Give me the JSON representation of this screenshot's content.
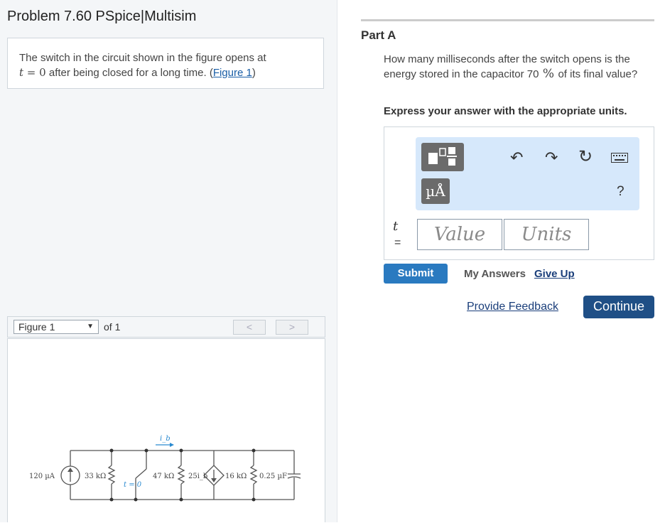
{
  "problem": {
    "title": "Problem 7.60 PSpice|Multisim",
    "text_before": "The switch in the circuit shown in the figure opens at",
    "t_var": "t",
    "eq_zero": " = 0",
    "text_after": " after being closed for a long time. (",
    "figure_link": "Figure 1",
    "close_paren": ")"
  },
  "figure": {
    "selected": "Figure 1",
    "of_text": "of 1",
    "prev": "<",
    "next": ">"
  },
  "circuit": {
    "src_label": "120 µA",
    "r1_label": "33 kΩ",
    "ib_label": "i_b",
    "switch_label": "t = 0",
    "r2_label": "47 kΩ",
    "dep_label": "25i_b",
    "r3_label": "16 kΩ",
    "cap_label": "0.25 µF"
  },
  "part": {
    "label": "Part A",
    "question_1": "How many milliseconds after the switch opens is the energy stored in the capacitor 70",
    "percent": " % ",
    "question_2": "of its final value?",
    "instruction": "Express your answer with the appropriate units."
  },
  "answer": {
    "t_var": "t",
    "equals": "=",
    "value_placeholder": "Value",
    "units_placeholder": "Units",
    "units_button": "µÅ",
    "help": "?"
  },
  "actions": {
    "submit": "Submit",
    "my_answers": "My Answers",
    "give_up": "Give Up",
    "feedback": "Provide Feedback",
    "continue": "Continue"
  }
}
